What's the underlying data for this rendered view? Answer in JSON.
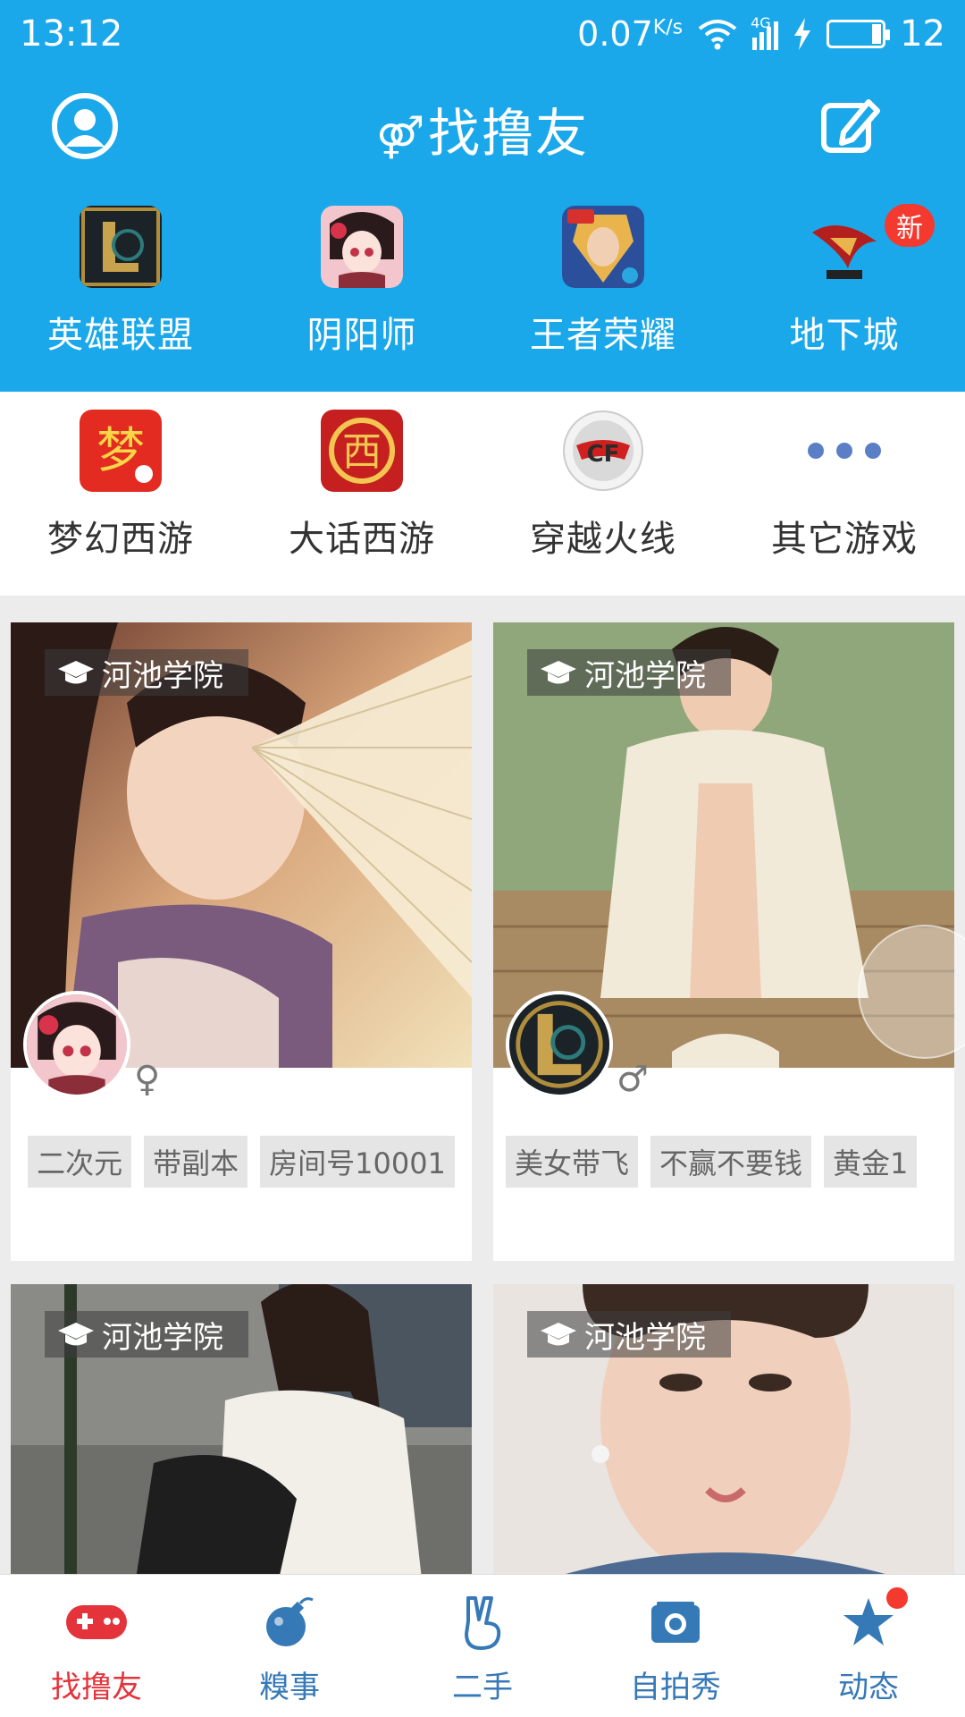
{
  "status_bar": {
    "time": "13:12",
    "speed": "0.07",
    "speed_unit": "K/s",
    "network": "4G",
    "battery": "12"
  },
  "header": {
    "title": "找撸友",
    "title_symbol": "⚤"
  },
  "games_top": [
    {
      "label": "英雄联盟",
      "icon": "league-of-legends-icon"
    },
    {
      "label": "阴阳师",
      "icon": "onmyoji-icon"
    },
    {
      "label": "王者荣耀",
      "icon": "honor-of-kings-icon"
    },
    {
      "label": "地下城",
      "icon": "dungeon-fighter-icon",
      "badge": "新"
    }
  ],
  "games_bottom": [
    {
      "label": "梦幻西游",
      "icon": "fantasy-westward-icon"
    },
    {
      "label": "大话西游",
      "icon": "westward-journey-icon"
    },
    {
      "label": "穿越火线",
      "icon": "crossfire-icon"
    },
    {
      "label": "其它游戏",
      "icon": "more-dots-icon"
    }
  ],
  "cards": [
    {
      "school": "河池学院",
      "gender": "♀",
      "tags": [
        "二次元",
        "带副本",
        "房间号10001"
      ]
    },
    {
      "school": "河池学院",
      "gender": "♂",
      "tags": [
        "美女带飞",
        "不赢不要钱",
        "黄金1"
      ]
    },
    {
      "school": "河池学院"
    },
    {
      "school": "河池学院"
    }
  ],
  "bottom_nav": [
    {
      "label": "找撸友",
      "icon": "gamepad-icon",
      "active": true
    },
    {
      "label": "糗事",
      "icon": "bomb-icon"
    },
    {
      "label": "二手",
      "icon": "peace-hand-icon"
    },
    {
      "label": "自拍秀",
      "icon": "camera-icon"
    },
    {
      "label": "动态",
      "icon": "star-icon",
      "dot": true
    }
  ],
  "colors": {
    "header_blue": "#1aa8ea",
    "active_red": "#e4333b",
    "nav_blue": "#3679b7",
    "badge_red": "#f4392f"
  }
}
